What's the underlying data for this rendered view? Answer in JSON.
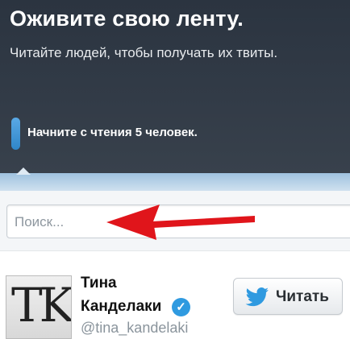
{
  "hero": {
    "title": "Оживите свою ленту.",
    "subtitle": "Читайте людей, чтобы получать их твиты."
  },
  "step": {
    "label": "Начните с чтения 5 человек."
  },
  "search": {
    "placeholder": "Поиск..."
  },
  "user": {
    "avatar_text": "TK",
    "name_line1": "Тина",
    "name_line2": "Канделаки",
    "handle": "@tina_kandelaki",
    "verified_icon": "verified-badge-icon",
    "follow_label": "Читать"
  },
  "colors": {
    "hero_bg": "#323b47",
    "accent_blue": "#2f9ae0",
    "arrow_red": "#e0151b"
  }
}
